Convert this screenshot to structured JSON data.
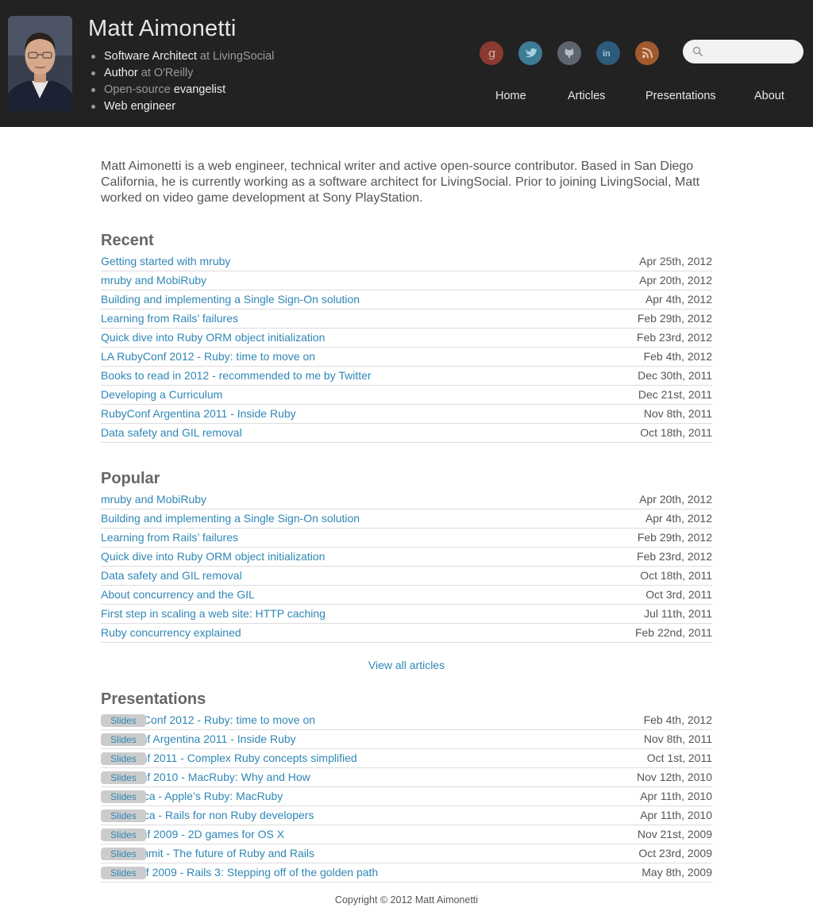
{
  "profile": {
    "name": "Matt Aimonetti",
    "roles": [
      {
        "highlight": "Software Architect",
        "rest": " at LivingSocial",
        "highlight_first": true
      },
      {
        "highlight": "Author",
        "rest": " at O'Reilly",
        "highlight_first": true
      },
      {
        "highlight": "evangelist",
        "rest": "Open-source ",
        "highlight_first": false
      },
      {
        "highlight": "Web engineer",
        "rest": "",
        "highlight_first": true
      }
    ]
  },
  "social": [
    "google-icon",
    "twitter-icon",
    "github-icon",
    "linkedin-icon",
    "rss-icon"
  ],
  "search": {
    "placeholder": "",
    "value": ""
  },
  "nav": {
    "home": "Home",
    "articles": "Articles",
    "presentations": "Presentations",
    "about": "About"
  },
  "intro": "Matt Aimonetti is a web engineer, technical writer and active open-source contributor. Based in San Diego California, he is currently working as a software architect for LivingSocial. Prior to joining LivingSocial, Matt worked on video game development at Sony PlayStation.",
  "recent": {
    "title": "Recent",
    "items": [
      {
        "title": "Getting started with mruby",
        "date": "Apr 25th, 2012"
      },
      {
        "title": "mruby and MobiRuby",
        "date": "Apr 20th, 2012"
      },
      {
        "title": "Building and implementing a Single Sign-On solution",
        "date": "Apr 4th, 2012"
      },
      {
        "title": "Learning from Rails’ failures",
        "date": "Feb 29th, 2012"
      },
      {
        "title": "Quick dive into Ruby ORM object initialization",
        "date": "Feb 23rd, 2012"
      },
      {
        "title": "LA RubyConf 2012 - Ruby: time to move on",
        "date": "Feb 4th, 2012"
      },
      {
        "title": "Books to read in 2012 - recommended to me by Twitter",
        "date": "Dec 30th, 2011"
      },
      {
        "title": "Developing a Curriculum",
        "date": "Dec 21st, 2011"
      },
      {
        "title": "RubyConf Argentina 2011 - Inside Ruby",
        "date": "Nov 8th, 2011"
      },
      {
        "title": "Data safety and GIL removal",
        "date": "Oct 18th, 2011"
      }
    ]
  },
  "popular": {
    "title": "Popular",
    "items": [
      {
        "title": "mruby and MobiRuby",
        "date": "Apr 20th, 2012"
      },
      {
        "title": "Building and implementing a Single Sign-On solution",
        "date": "Apr 4th, 2012"
      },
      {
        "title": "Learning from Rails’ failures",
        "date": "Feb 29th, 2012"
      },
      {
        "title": "Quick dive into Ruby ORM object initialization",
        "date": "Feb 23rd, 2012"
      },
      {
        "title": "Data safety and GIL removal",
        "date": "Oct 18th, 2011"
      },
      {
        "title": "About concurrency and the GIL",
        "date": "Oct 3rd, 2011"
      },
      {
        "title": "First step in scaling a web site: HTTP caching",
        "date": "Jul 11th, 2011"
      },
      {
        "title": "Ruby concurrency explained",
        "date": "Feb 22nd, 2011"
      }
    ]
  },
  "view_all": "View all articles",
  "presentations": {
    "title": "Presentations",
    "slides_label": "Slides",
    "items": [
      {
        "title": "LA RubyConf 2012 - Ruby: time to move on",
        "date": "Feb 4th, 2012"
      },
      {
        "title": "RubyConf Argentina 2011 - Inside Ruby",
        "date": "Nov 8th, 2011"
      },
      {
        "title": "RubyConf 2011 - Complex Ruby concepts simplified",
        "date": "Oct 1st, 2011"
      },
      {
        "title": "RubyConf 2010 - MacRuby: Why and How",
        "date": "Nov 12th, 2010"
      },
      {
        "title": "ConFoo.ca - Apple’s Ruby: MacRuby",
        "date": "Apr 11th, 2010"
      },
      {
        "title": "ConFoo.ca - Rails for non Ruby developers",
        "date": "Apr 11th, 2010"
      },
      {
        "title": "RubyConf 2009 - 2D games for OS X",
        "date": "Nov 21st, 2009"
      },
      {
        "title": "RailsSummit - The future of Ruby and Rails",
        "date": "Oct 23rd, 2009"
      },
      {
        "title": "RailsConf 2009 - Rails 3: Stepping off of the golden path",
        "date": "May 8th, 2009"
      }
    ]
  },
  "footer": "Copyright © 2012 Matt Aimonetti"
}
